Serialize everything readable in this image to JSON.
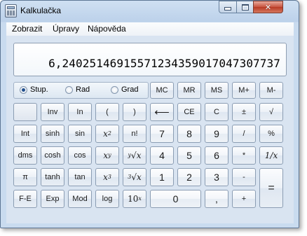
{
  "window": {
    "title": "Kalkulačka"
  },
  "menu": [
    "Zobrazit",
    "Úpravy",
    "Nápověda"
  ],
  "display": {
    "value": "6,24025146915571234359017047307737"
  },
  "angle_units": [
    {
      "label": "Stup.",
      "checked": true
    },
    {
      "label": "Rad",
      "checked": false
    },
    {
      "label": "Grad",
      "checked": false
    }
  ],
  "memory_buttons": [
    "MC",
    "MR",
    "MS",
    "M+",
    "M-"
  ],
  "buttons": {
    "inv": "Inv",
    "ln": "In",
    "open_paren": "(",
    "close_paren": ")",
    "backspace": "⟵",
    "ce": "CE",
    "c": "C",
    "plus_minus": "±",
    "sqrt": "√",
    "int": "Int",
    "sinh": "sinh",
    "sin": "sin",
    "x_sq_base": "x",
    "x_sq_exp": "2",
    "factorial": "n!",
    "seven": "7",
    "eight": "8",
    "nine": "9",
    "divide": "/",
    "percent": "%",
    "dms": "dms",
    "cosh": "cosh",
    "cos": "cos",
    "x_pow_y_base": "x",
    "x_pow_y_exp": "y",
    "yroot_idx": "y",
    "yroot_sym": "√",
    "yroot_var": "x",
    "four": "4",
    "five": "5",
    "six": "6",
    "multiply": "*",
    "reciprocal": "1/x",
    "pi": "π",
    "tanh": "tanh",
    "tan": "tan",
    "x_cube_base": "x",
    "x_cube_exp": "3",
    "cuberoot_idx": "3",
    "cuberoot_sym": "√",
    "cuberoot_var": "x",
    "one": "1",
    "two": "2",
    "three": "3",
    "minus": "-",
    "equals": "=",
    "fe": "F-E",
    "exp": "Exp",
    "mod": "Mod",
    "log": "log",
    "ten_pow_base": "10",
    "ten_pow_exp": "x",
    "zero": "0",
    "decimal": ",",
    "plus": "+"
  }
}
